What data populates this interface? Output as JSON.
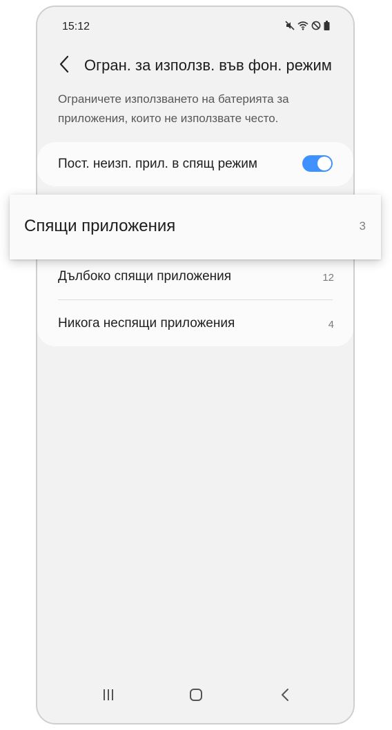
{
  "status_bar": {
    "time": "15:12",
    "icons": [
      "mute-icon",
      "wifi-icon",
      "do-not-disturb-icon",
      "battery-icon"
    ]
  },
  "header": {
    "back_icon": "chevron-left-icon",
    "title": "Огран. за използв. във фон. режим"
  },
  "description": "Ограничете използването на батерията за приложения, които не използвате често.",
  "toggle_setting": {
    "label": "Пост. неизп. прил. в спящ режим",
    "enabled": true,
    "accent_color": "#3e91ff"
  },
  "app_lists": [
    {
      "label": "Спящи приложения",
      "count": "3"
    },
    {
      "label": "Дълбоко спящи приложения",
      "count": "12"
    },
    {
      "label": "Никога неспящи приложения",
      "count": "4"
    }
  ],
  "nav_bar": {
    "icons": [
      "recent-apps-icon",
      "home-icon",
      "back-icon"
    ]
  }
}
